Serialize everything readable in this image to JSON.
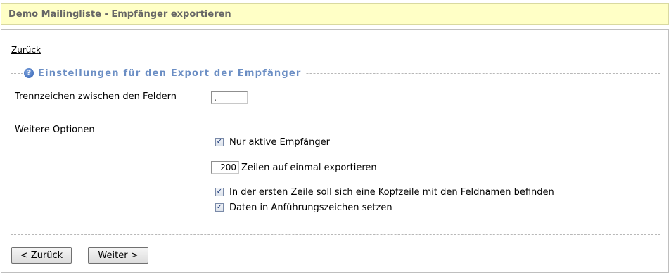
{
  "header": {
    "title": "Demo Mailingliste - Empfänger exportieren"
  },
  "back_link": "Zurück",
  "fieldset": {
    "legend": "Einstellungen für den Export der Empfänger"
  },
  "separator": {
    "label": "Trennzeichen zwischen den Feldern",
    "value": ","
  },
  "options": {
    "label": "Weitere Optionen",
    "only_active": {
      "label": "Nur aktive Empfänger",
      "checked": true
    },
    "rows_per_export": {
      "value": "200",
      "label": "Zeilen auf einmal exportieren"
    },
    "header_row": {
      "label": "In der ersten Zeile soll sich eine Kopfzeile mit den Feldnamen befinden",
      "checked": true
    },
    "quotes": {
      "label": "Daten in Anführungszeichen setzen",
      "checked": true
    }
  },
  "buttons": {
    "back": "< Zurück",
    "next": "Weiter >"
  }
}
